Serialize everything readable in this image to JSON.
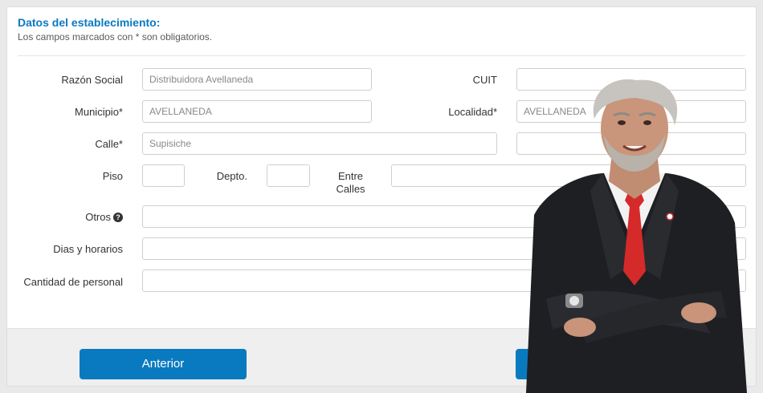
{
  "header": {
    "title": "Datos del establecimiento:",
    "subtitle": "Los campos marcados con * son obligatorios."
  },
  "fields": {
    "razon_social": {
      "label": "Razón Social",
      "value": "Distribuidora Avellaneda"
    },
    "cuit": {
      "label": "CUIT",
      "value": ""
    },
    "municipio": {
      "label": "Municipio*",
      "value": "AVELLANEDA"
    },
    "localidad": {
      "label": "Localidad*",
      "value": "AVELLANEDA"
    },
    "calle": {
      "label": "Calle*",
      "value": "Supisiche"
    },
    "piso": {
      "label": "Piso",
      "value": ""
    },
    "depto": {
      "label": "Depto.",
      "value": ""
    },
    "entre_calles": {
      "label": "Entre\nCalles",
      "value": ""
    },
    "otros": {
      "label": "Otros",
      "value": ""
    },
    "dias_horarios": {
      "label": "Dias y horarios",
      "value": ""
    },
    "cantidad_personal": {
      "label": "Cantidad de personal",
      "value": ""
    }
  },
  "footer": {
    "prev_label": "Anterior"
  },
  "icons": {
    "help": "question-circle-icon"
  },
  "colors": {
    "accent": "#0a7ac0",
    "tie": "#d42a2a",
    "suit": "#1e1f22"
  }
}
